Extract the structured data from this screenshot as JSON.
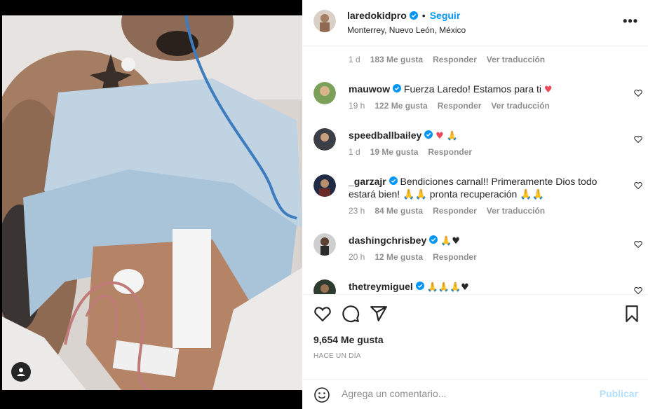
{
  "post": {
    "username": "laredokidpro",
    "separator": "•",
    "follow_label": "Seguir",
    "location": "Monterrey, Nuevo León, México",
    "more_label": "•••",
    "likes": "9,654 Me gusta",
    "time_ago": "HACE UN DÍA"
  },
  "comments": [
    {
      "time": "1 d",
      "likes": "183 Me gusta",
      "reply": "Responder",
      "translate": "Ver traducción"
    },
    {
      "username": "mauwow",
      "text": "Fuerza Laredo! Estamos para ti",
      "emoji": "♥",
      "time": "19 h",
      "likes": "122 Me gusta",
      "reply": "Responder",
      "translate": "Ver traducción"
    },
    {
      "username": "speedballbailey",
      "text": "",
      "emoji": "♥ 🙏",
      "time": "1 d",
      "likes": "19 Me gusta",
      "reply": "Responder"
    },
    {
      "username": "_garzajr",
      "text": "Bendiciones carnal!! Primeramente Dios todo estará bien! 🙏🙏 pronta recuperación 🙏🙏",
      "time": "23 h",
      "likes": "84 Me gusta",
      "reply": "Responder",
      "translate": "Ver traducción"
    },
    {
      "username": "dashingchrisbey",
      "text": "",
      "emoji": "🙏♥",
      "time": "20 h",
      "likes": "12 Me gusta",
      "reply": "Responder"
    },
    {
      "username": "thetreymiguel",
      "text": "",
      "emoji": "🙏🙏🙏♥"
    }
  ],
  "composer": {
    "placeholder": "Agrega un comentario...",
    "publish_label": "Publicar"
  },
  "colors": {
    "accent": "#0095f6",
    "heart_red": "#ed4956",
    "muted": "#8e8e8e",
    "publish_disabled": "#b2dffc"
  }
}
